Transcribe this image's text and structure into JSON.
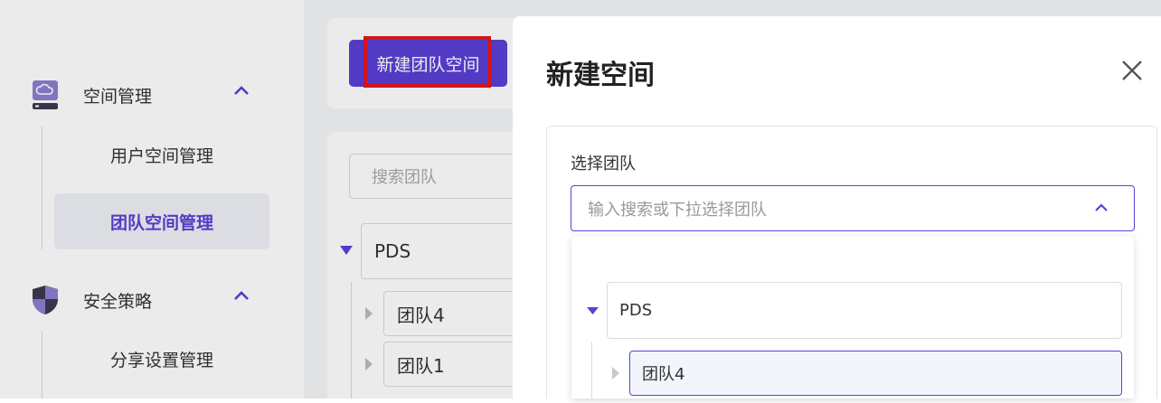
{
  "sidebar": {
    "groups": [
      {
        "label": "空间管理",
        "items": [
          "用户空间管理",
          "团队空间管理"
        ],
        "active": "团队空间管理"
      },
      {
        "label": "安全策略",
        "items": [
          "分享设置管理"
        ]
      }
    ]
  },
  "main": {
    "new_team_button": "新建团队空间",
    "search_placeholder": "搜索团队",
    "tree": {
      "root": "PDS",
      "children": [
        "团队4",
        "团队1"
      ]
    }
  },
  "drawer": {
    "title": "新建空间",
    "form_label": "选择团队",
    "select_placeholder": "输入搜索或下拉选择团队",
    "dropdown": {
      "root": "PDS",
      "children": [
        "团队4"
      ],
      "selected": "团队4"
    }
  },
  "colors": {
    "accent": "#5b3fd6",
    "highlight": "#e5161d"
  }
}
